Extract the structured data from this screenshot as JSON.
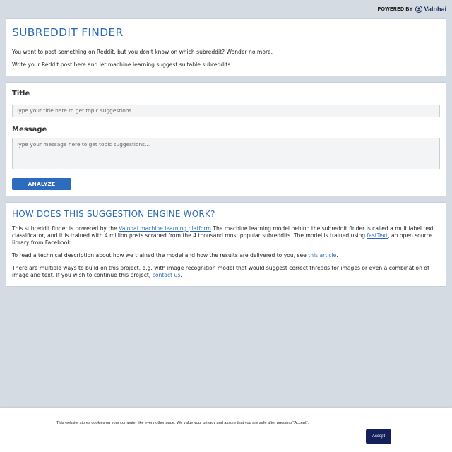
{
  "header": {
    "powered_by": "POWERED BY",
    "brand": "Valohai",
    "brand_icon": "valohai-logo-icon"
  },
  "intro": {
    "title": "SUBREDDIT FINDER",
    "line1": "You want to post something on Reddit, but you don't know on which subreddit? Wonder no more.",
    "line2": "Write your Reddit post here and let machine learning suggest suitable subreddits."
  },
  "form": {
    "title_label": "Title",
    "title_placeholder": "Type your title here to get topic suggestions...",
    "title_value": "",
    "message_label": "Message",
    "message_placeholder": "Type your message here to get topic suggestions...",
    "message_value": "",
    "analyze_label": "ANALYZE"
  },
  "how": {
    "title": "HOW DOES THIS SUGGESTION ENGINE WORK?",
    "p1_pre": "This subreddit finder is powered by the ",
    "p1_link": "Valohai machine learning platform",
    "p1_mid": ".The machine learning model behind the subreddit finder is called a multilabel text classificator, and it is trained with 4 million posts scraped from the 4 thousand most popular subreddits. The model is trained using ",
    "p1_link2": "fastText",
    "p1_post": ", an open source library from Facebook.",
    "p2_pre": "To read a technical description about how we trained the model and how the results are delivered to you, see ",
    "p2_link": "this article",
    "p2_post": ".",
    "p3_pre": "There are multiple ways to build on this project, e.g. with image recognition model that would suggest correct threads for images or even a combination of image and text. If you wish to continue this project, ",
    "p3_link": "contact us",
    "p3_post": "."
  },
  "cookie": {
    "text": "This website stores cookies on your computer like every other page. We value your privacy and assure that you are safe after pressing \"Accept\".",
    "accept_label": "Accept"
  },
  "colors": {
    "background": "#d5dbe2",
    "accent": "#2a6ab6",
    "button": "#2c6bbd",
    "accept_button": "#13205a"
  }
}
